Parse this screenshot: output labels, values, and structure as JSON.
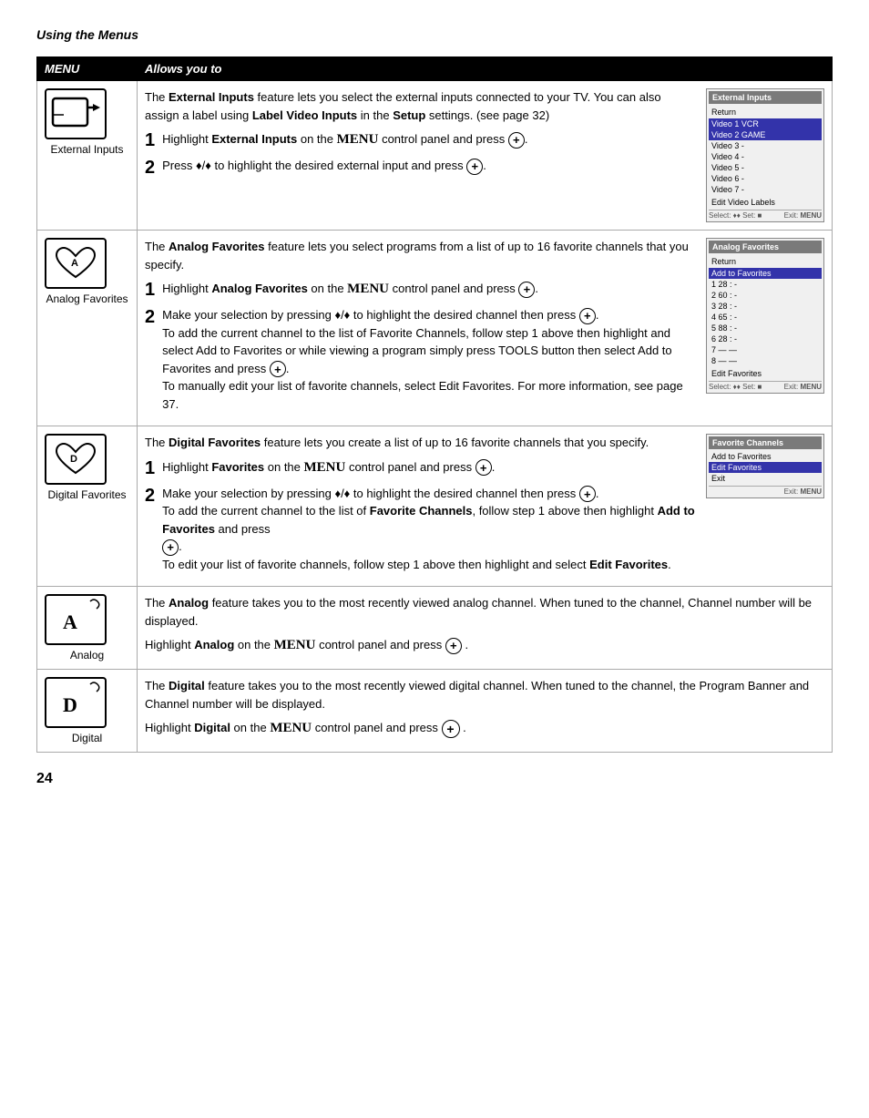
{
  "page": {
    "title": "Using the Menus",
    "page_number": "24"
  },
  "table": {
    "col1_header": "MENU",
    "col2_header": "Allows you to",
    "rows": [
      {
        "id": "external-inputs",
        "menu_label": "External Inputs",
        "icon_type": "external-input",
        "description": "The External Inputs feature lets you select the external inputs connected to your TV. You can also assign a label using Label Video Inputs in the Setup settings. (see page 32)",
        "steps": [
          {
            "num": "1",
            "text": "Highlight External Inputs on the MENU control panel and press"
          },
          {
            "num": "2",
            "text": "Press ♦/♦ to highlight the desired external input and press"
          }
        ],
        "screenshot": {
          "title": "External Inputs",
          "return_label": "Return",
          "items": [
            {
              "label": "Video 1   VCR",
              "highlighted": true
            },
            {
              "label": "Video 2   GAME",
              "highlighted": true
            },
            {
              "label": "Video 3  -",
              "highlighted": false
            },
            {
              "label": "Video 4  -",
              "highlighted": false
            },
            {
              "label": "Video 5  -",
              "highlighted": false
            },
            {
              "label": "Video 6  -",
              "highlighted": false
            },
            {
              "label": "Video 7  -",
              "highlighted": false
            },
            {
              "label": "Edit Video Labels",
              "highlighted": false
            }
          ],
          "footer_select": "Select: ♦♦ Set: ■",
          "footer_exit": "Exit: MENU"
        }
      },
      {
        "id": "analog-favorites",
        "menu_label": "Analog Favorites",
        "icon_type": "heart-a",
        "description": "The Analog Favorites feature lets you select programs from a list of up to 16 favorite channels that you specify.",
        "steps": [
          {
            "num": "1",
            "text": "Highlight Analog Favorites on the MENU control panel and press"
          },
          {
            "num": "2",
            "text": "Make your selection by pressing ♦/♦ to highlight the desired channel then press"
          }
        ],
        "extra_text": "To add the current channel to the list of Favorite Channels, follow step 1 above then highlight and select Add to Favorites or while viewing a program simply press TOOLS button then select Add to Favorites and press ⊕. To manually edit your list of favorite channels, select Edit Favorites. For more information, see page 37.",
        "screenshot": {
          "title": "Analog Favorites",
          "return_label": "Return",
          "items": [
            {
              "label": "Add to Favorites",
              "highlighted": true
            },
            {
              "label": "1   28 :  -",
              "highlighted": false
            },
            {
              "label": "2   60 :  -",
              "highlighted": false
            },
            {
              "label": "3   28 :  -",
              "highlighted": false
            },
            {
              "label": "4   65 :  -",
              "highlighted": false
            },
            {
              "label": "5   88 :  -",
              "highlighted": false
            },
            {
              "label": "6   28 :  -",
              "highlighted": false
            },
            {
              "label": "7     -     -",
              "highlighted": false
            },
            {
              "label": "8     -     -",
              "highlighted": false
            },
            {
              "label": "Edit Favorites",
              "highlighted": false
            }
          ],
          "footer_select": "Select: ♦♦ Set: ■",
          "footer_exit": "Exit: MENU"
        }
      },
      {
        "id": "digital-favorites",
        "menu_label": "Digital Favorites",
        "icon_type": "heart-d",
        "description": "The Digital Favorites feature lets you create a list of up to 16 favorite channels that you specify.",
        "steps": [
          {
            "num": "1",
            "text": "Highlight Favorites on the MENU control panel and press"
          },
          {
            "num": "2",
            "text": "Make your selection by pressing ♦/♦ to highlight the desired channel then press"
          }
        ],
        "extra_text1": "To add the current channel to the list of Favorite Channels, follow step 1 above then highlight Add to Favorites and press ⊕.",
        "extra_text2": "To edit your list of favorite channels, follow step 1 above then highlight and select Edit Favorites.",
        "screenshot": {
          "title": "Favorite Channels",
          "items": [
            {
              "label": "Add to Favorites",
              "highlighted": false
            },
            {
              "label": "Edit Favorites",
              "highlighted": true
            },
            {
              "label": "Exit",
              "highlighted": false
            }
          ],
          "footer_exit": "Exit: MENU"
        }
      },
      {
        "id": "analog",
        "menu_label": "Analog",
        "icon_type": "letter-a",
        "description1": "The Analog feature takes you to the most recently viewed analog channel.  When tuned to the channel, Channel number will be displayed.",
        "description2": "Highlight Analog on the MENU control panel and press"
      },
      {
        "id": "digital",
        "menu_label": "Digital",
        "icon_type": "letter-d",
        "description1": "The Digital feature takes you to the most recently viewed digital channel.  When tuned to the channel, the Program Banner and Channel number will be displayed.",
        "description2": "Highlight Digital on the MENU control panel and press"
      }
    ]
  }
}
